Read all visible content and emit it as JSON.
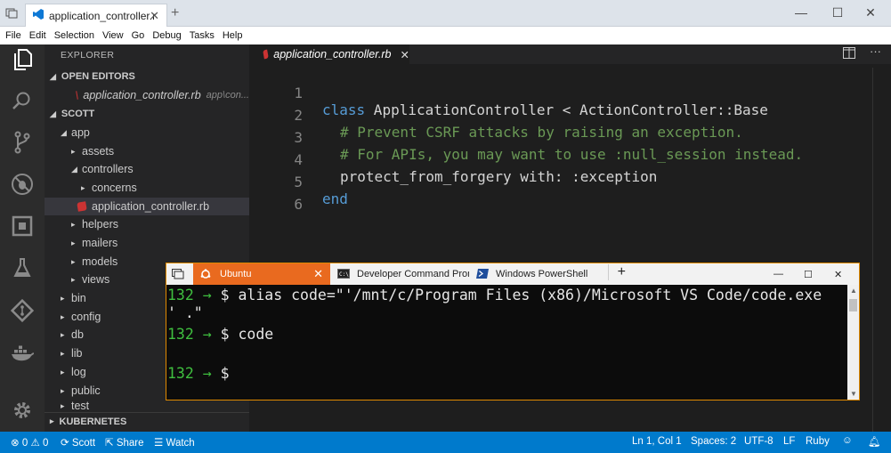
{
  "window": {
    "tab_title": "application_controller.r",
    "menu": [
      "File",
      "Edit",
      "Selection",
      "View",
      "Go",
      "Debug",
      "Tasks",
      "Help"
    ]
  },
  "sidebar": {
    "title": "EXPLORER",
    "open_editors_label": "OPEN EDITORS",
    "open_editor": {
      "file": "application_controller.rb",
      "path": "app\\con..."
    },
    "project_label": "SCOTT",
    "tree": [
      {
        "label": "app",
        "kind": "folder-open"
      },
      {
        "label": "assets",
        "kind": "folder"
      },
      {
        "label": "controllers",
        "kind": "folder-open"
      },
      {
        "label": "concerns",
        "kind": "folder"
      },
      {
        "label": "application_controller.rb",
        "kind": "file"
      },
      {
        "label": "helpers",
        "kind": "folder"
      },
      {
        "label": "mailers",
        "kind": "folder"
      },
      {
        "label": "models",
        "kind": "folder"
      },
      {
        "label": "views",
        "kind": "folder"
      },
      {
        "label": "bin",
        "kind": "folder"
      },
      {
        "label": "config",
        "kind": "folder"
      },
      {
        "label": "db",
        "kind": "folder"
      },
      {
        "label": "lib",
        "kind": "folder"
      },
      {
        "label": "log",
        "kind": "folder"
      },
      {
        "label": "public",
        "kind": "folder"
      },
      {
        "label": "test",
        "kind": "folder"
      }
    ],
    "kubernetes_label": "KUBERNETES"
  },
  "editor": {
    "tab_label": "application_controller.rb",
    "line_numbers": [
      "1",
      "2",
      "3",
      "4",
      "5",
      "6"
    ],
    "lines": [
      {
        "kw": "class",
        "rest": " ApplicationController < ActionController::Base"
      },
      {
        "comment": "# Prevent CSRF attacks by raising an exception."
      },
      {
        "comment": "# For APIs, you may want to use :null_session instead."
      },
      {
        "code": "protect_from_forgery with: :exception"
      },
      {
        "kw": "end"
      },
      {
        "code": ""
      }
    ]
  },
  "terminal": {
    "tabs": [
      "Ubuntu",
      "Developer Command Prom",
      "Windows PowerShell"
    ],
    "prompt_num": "132",
    "arrow": "→",
    "lines": [
      {
        "cmd": "$ alias code=\"'/mnt/c/Program Files (x86)/Microsoft VS Code/code.exe"
      },
      {
        "cont": "' .\""
      },
      {
        "cmd": "$ code"
      },
      {
        "cmd": "$ "
      }
    ]
  },
  "status": {
    "errors": "0",
    "warnings": "0",
    "user": "Scott",
    "share": "Share",
    "watch": "Watch",
    "position": "Ln 1, Col 1",
    "spaces": "Spaces: 2",
    "encoding": "UTF-8",
    "eol": "LF",
    "language": "Ruby"
  },
  "colors": {
    "accent": "#007acc",
    "terminal_tab_active": "#e96a1f",
    "ruby": "#cc3333"
  }
}
